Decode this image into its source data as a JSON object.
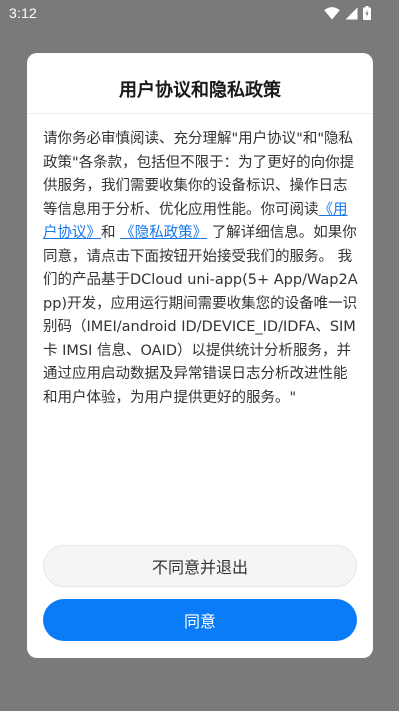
{
  "status_bar": {
    "time": "3:12",
    "icons": [
      "wifi-icon",
      "cellular-signal-icon",
      "battery-icon"
    ]
  },
  "dialog": {
    "title": "用户协议和隐私政策",
    "body_intro": "请你务必审慎阅读、充分理解\"用户协议\"和\"隐私政策\"各条款，包括但不限于：为了更好的向你提供服务，我们需要收集你的设备标识、操作日志等信息用于分析、优化应用性能。你可阅读",
    "user_agreement_link": "《用户协议》",
    "and_text": "和",
    "privacy_policy_link": "《隐私政策》",
    "body_outro": "了解详细信息。如果你同意，请点击下面按钮开始接受我们的服务。 我们的产品基于DCloud uni-app(5+ App/Wap2App)开发，应用运行期间需要收集您的设备唯一识别码（IMEI/android ID/DEVICE_ID/IDFA、SIM 卡 IMSI 信息、OAID）以提供统计分析服务，并通过应用启动数据及异常错误日志分析改进性能和用户体验，为用户提供更好的服务。\"",
    "decline_label": "不同意并退出",
    "agree_label": "同意"
  },
  "colors": {
    "overlay": "#7a7a7a",
    "link": "#1677e8",
    "primary_button": "#0a7cf8",
    "secondary_button": "#f5f5f5"
  }
}
